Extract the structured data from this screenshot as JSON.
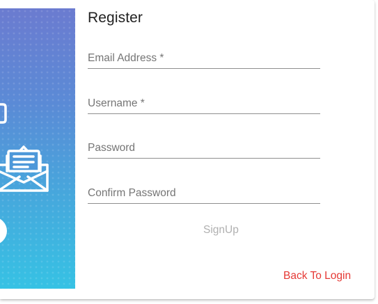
{
  "form": {
    "title": "Register",
    "fields": [
      {
        "label": "Email Address *",
        "value": ""
      },
      {
        "label": "Username *",
        "value": ""
      },
      {
        "label": "Password",
        "value": ""
      },
      {
        "label": "Confirm Password",
        "value": ""
      }
    ],
    "signup_label": "SignUp",
    "back_to_login_label": "Back To Login"
  },
  "side_panel": {
    "icons": [
      "chat-bubble-icon",
      "envelope-icon",
      "circle-icon"
    ]
  },
  "colors": {
    "panel_gradient_top": "#6b7bd0",
    "panel_gradient_bottom": "#36c2e4",
    "link_red": "#e53935",
    "disabled_text": "#b0b0b0"
  }
}
